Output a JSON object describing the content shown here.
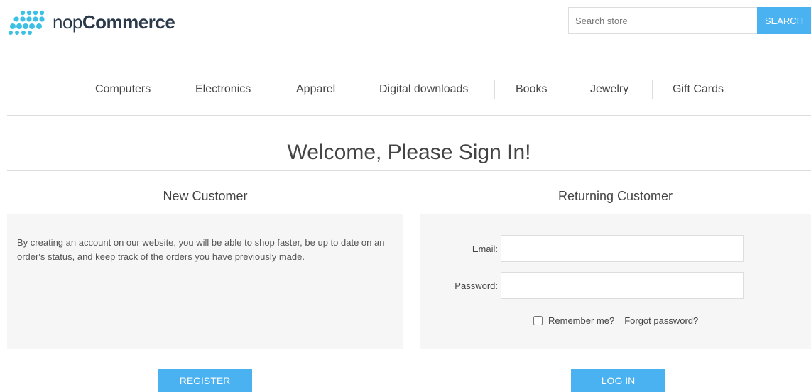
{
  "header": {
    "logo": {
      "text_light": "nop",
      "text_bold": "Commerce",
      "icon": "nopcommerce-dots-logo",
      "dot_color": "#3cc0e6"
    },
    "search": {
      "placeholder": "Search store",
      "value": "",
      "button_label": "Search"
    }
  },
  "menu": {
    "items": [
      {
        "label": "Computers"
      },
      {
        "label": "Electronics"
      },
      {
        "label": "Apparel"
      },
      {
        "label": "Digital downloads"
      },
      {
        "label": "Books"
      },
      {
        "label": "Jewelry"
      },
      {
        "label": "Gift Cards"
      }
    ]
  },
  "page": {
    "title": "Welcome, Please Sign In!"
  },
  "new_customer": {
    "title": "New Customer",
    "text": "By creating an account on our website, you will be able to shop faster, be up to date on an order's status, and keep track of the orders you have previously made.",
    "register_label": "Register"
  },
  "returning_customer": {
    "title": "Returning Customer",
    "email_label": "Email:",
    "email_value": "",
    "password_label": "Password:",
    "password_value": "",
    "remember_label": "Remember me?",
    "remember_checked": false,
    "forgot_label": "Forgot password?",
    "login_label": "Log in"
  },
  "colors": {
    "accent": "#4ab2f1",
    "panel_bg": "#f6f6f6",
    "border": "#dddddd",
    "text": "#444444"
  }
}
